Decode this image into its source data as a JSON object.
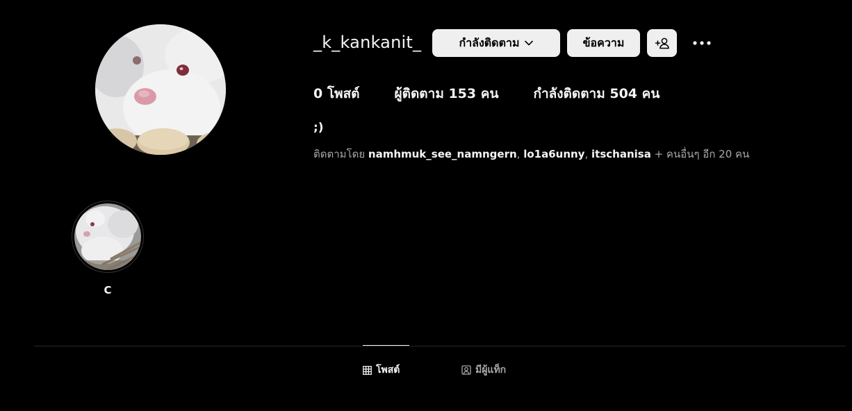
{
  "profile": {
    "username": "_k_kankanit_",
    "bio": ";)"
  },
  "actions": {
    "following_label": "กำลังติดตาม",
    "message_label": "ข้อความ",
    "add_user_icon": "add-user-icon",
    "more_icon": "more-options-icon"
  },
  "stats": {
    "posts": "0 โพสต์",
    "followers": "ผู้ติดตาม 153 คน",
    "following": "กำลังติดตาม 504 คน"
  },
  "followed_by": {
    "prefix": "ติดตามโดย ",
    "users": [
      "namhmuk_see_namngern",
      "lo1a6unny",
      "itschanisa"
    ],
    "separator": ", ",
    "suffix": " + คนอื่นๆ อีก 20 คน"
  },
  "highlights": [
    {
      "label": "C"
    }
  ],
  "tabs": [
    {
      "label": "โพสต์",
      "icon": "grid-icon",
      "active": true
    },
    {
      "label": "มีผู้แท็ก",
      "icon": "tagged-icon",
      "active": false
    }
  ],
  "colors": {
    "background": "#000000",
    "text_primary": "#f5f5f5",
    "text_secondary": "#a8a8a8",
    "button_bg": "#efefef",
    "divider": "#262626"
  }
}
